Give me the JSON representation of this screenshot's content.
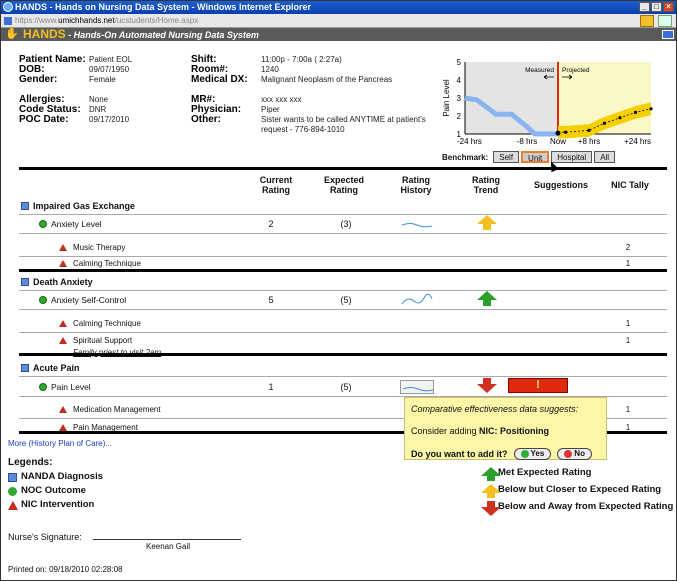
{
  "window": {
    "title": "HANDS - Hands on Nursing Data System - Windows Internet Explorer",
    "url_prefix": "https://www.",
    "url_host": "umichhands.net",
    "url_path": "/ucstudents/Home.aspx"
  },
  "app": {
    "brand": "HANDS",
    "tagline": "- Hands-On Automated Nursing Data System"
  },
  "patient": {
    "col1": [
      {
        "label": "Patient Name:",
        "value": "Patient EOL"
      },
      {
        "label": "DOB:",
        "value": "09/07/1950"
      },
      {
        "label": "Gender:",
        "value": "Female"
      },
      {
        "label": "Allergies:",
        "value": "None"
      },
      {
        "label": "Code Status:",
        "value": "DNR"
      },
      {
        "label": "POC Date:",
        "value": "09/17/2010"
      }
    ],
    "col2": [
      {
        "label": "Shift:",
        "value": "11:00p - 7:00a ( 2:27a)"
      },
      {
        "label": "Room#:",
        "value": "1240"
      },
      {
        "label": "Medical DX:",
        "value": "Malignant Neoplasm of the Pancreas"
      },
      {
        "label": "MR#:",
        "value": "xxx xxx xxx"
      },
      {
        "label": "Physician:",
        "value": "Piper"
      },
      {
        "label": "Other:",
        "value": "Sister wants to be called ANYTIME at patient's"
      },
      {
        "label": "",
        "value": "request - 776-894-1010"
      }
    ]
  },
  "chart_data": {
    "type": "line",
    "ylabel": "Pain Level",
    "ylim": [
      1,
      5
    ],
    "x_ticks": [
      "-24 hrs",
      "-8 hrs",
      "Now",
      "+8 hrs",
      "+24 hrs"
    ],
    "y_ticks": [
      "1",
      "2",
      "3",
      "4",
      "5"
    ],
    "regions": [
      "Measured",
      "Projected"
    ],
    "series": [
      {
        "name": "Measured",
        "x": [
          -24,
          -21,
          -16,
          -12,
          -8,
          -6,
          0
        ],
        "y": [
          3.0,
          2.9,
          2.1,
          2.1,
          1.4,
          1.0,
          1.0
        ]
      },
      {
        "name": "Projected",
        "x": [
          0,
          2,
          8,
          12,
          16,
          20,
          24
        ],
        "y": [
          1.1,
          1.1,
          1.2,
          1.6,
          1.9,
          2.2,
          2.4
        ]
      }
    ],
    "colors": {
      "measured": "#8ab4f0",
      "projected": "#f5d000",
      "now_line": "#e02a10"
    }
  },
  "benchmark": {
    "label": "Benchmark:",
    "buttons": [
      "Self",
      "Unit",
      "Hospital",
      "All"
    ],
    "selected": "Unit"
  },
  "columns": {
    "current": "Current\nRating",
    "expected": "Expected\nRating",
    "history": "Rating\nHistory",
    "trend": "Rating\nTrend",
    "suggestions": "Suggestions",
    "nic_tally": "NIC Tally"
  },
  "sections": [
    {
      "name": "Impaired Gas Exchange",
      "noc": "Anxiety Level",
      "current": "2",
      "expected": "(3)",
      "trend": "yellow",
      "nics": [
        {
          "name": "Music Therapy",
          "tally": "2"
        },
        {
          "name": "Calming Technique",
          "tally": "1"
        }
      ]
    },
    {
      "name": "Death Anxiety",
      "noc": "Anxiety Self-Control",
      "current": "5",
      "expected": "(5)",
      "trend": "green",
      "nics": [
        {
          "name": "Calming Technique",
          "tally": "1"
        },
        {
          "name": "Spiritual Support",
          "tally": "1",
          "note": "Family priest to visit 2am"
        }
      ]
    },
    {
      "name": "Acute Pain",
      "noc": "Pain Level",
      "current": "1",
      "expected": "(5)",
      "trend": "red",
      "nics": [
        {
          "name": "Medication Management",
          "tally": "1"
        },
        {
          "name": "Pain Management",
          "tally": "1"
        }
      ]
    }
  ],
  "alert": {
    "symbol": "!"
  },
  "popup": {
    "line1": "Comparative effectiveness data suggests:",
    "line2_prefix": "Consider adding ",
    "line2_bold": "NIC: Positioning",
    "question": "Do you want to add it?",
    "yes": "Yes",
    "no": "No"
  },
  "more_link": "More (History Plan of Care)...",
  "legend": {
    "title": "Legends:",
    "left": [
      "NANDA Diagnosis",
      "NOC Outcome",
      "NIC Intervention"
    ],
    "right": [
      "Met Expected Rating",
      "Below but Closer to Expeced Rating",
      "Below and Away from Expected Rating"
    ]
  },
  "signature": {
    "label": "Nurse's Signature:",
    "name": "Keenan Gail"
  },
  "printed": {
    "label": "Printed on:",
    "value": "09/18/2010 02:28:08"
  }
}
